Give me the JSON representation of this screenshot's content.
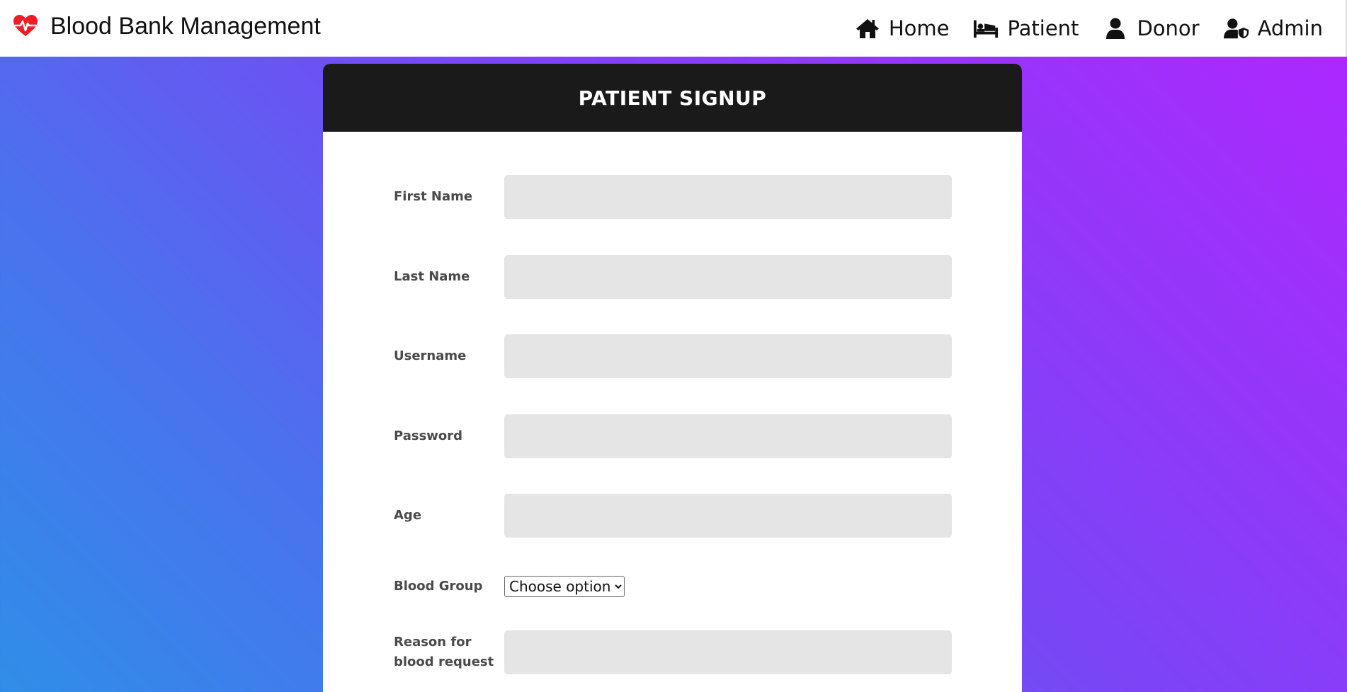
{
  "brand": {
    "title": "Blood Bank Management",
    "icon": "heart-pulse-icon",
    "icon_color": "#ee1c25"
  },
  "nav": {
    "items": [
      {
        "label": "Home",
        "icon": "home-icon"
      },
      {
        "label": "Patient",
        "icon": "patient-bed-icon"
      },
      {
        "label": "Donor",
        "icon": "user-icon"
      },
      {
        "label": "Admin",
        "icon": "user-shield-icon"
      }
    ]
  },
  "form": {
    "title": "PATIENT SIGNUP",
    "fields": {
      "first_name": {
        "label": "First Name",
        "value": ""
      },
      "last_name": {
        "label": "Last Name",
        "value": ""
      },
      "username": {
        "label": "Username",
        "value": ""
      },
      "password": {
        "label": "Password",
        "value": ""
      },
      "age": {
        "label": "Age",
        "value": ""
      },
      "blood_group": {
        "label": "Blood Group",
        "selected": "Choose option"
      },
      "reason": {
        "label": "Reason for blood request",
        "value": ""
      }
    }
  },
  "colors": {
    "header_bg": "#1a1a1a",
    "input_bg": "#e5e5e5",
    "gradient_start": "#2f8ee8",
    "gradient_end": "#b026ff"
  }
}
